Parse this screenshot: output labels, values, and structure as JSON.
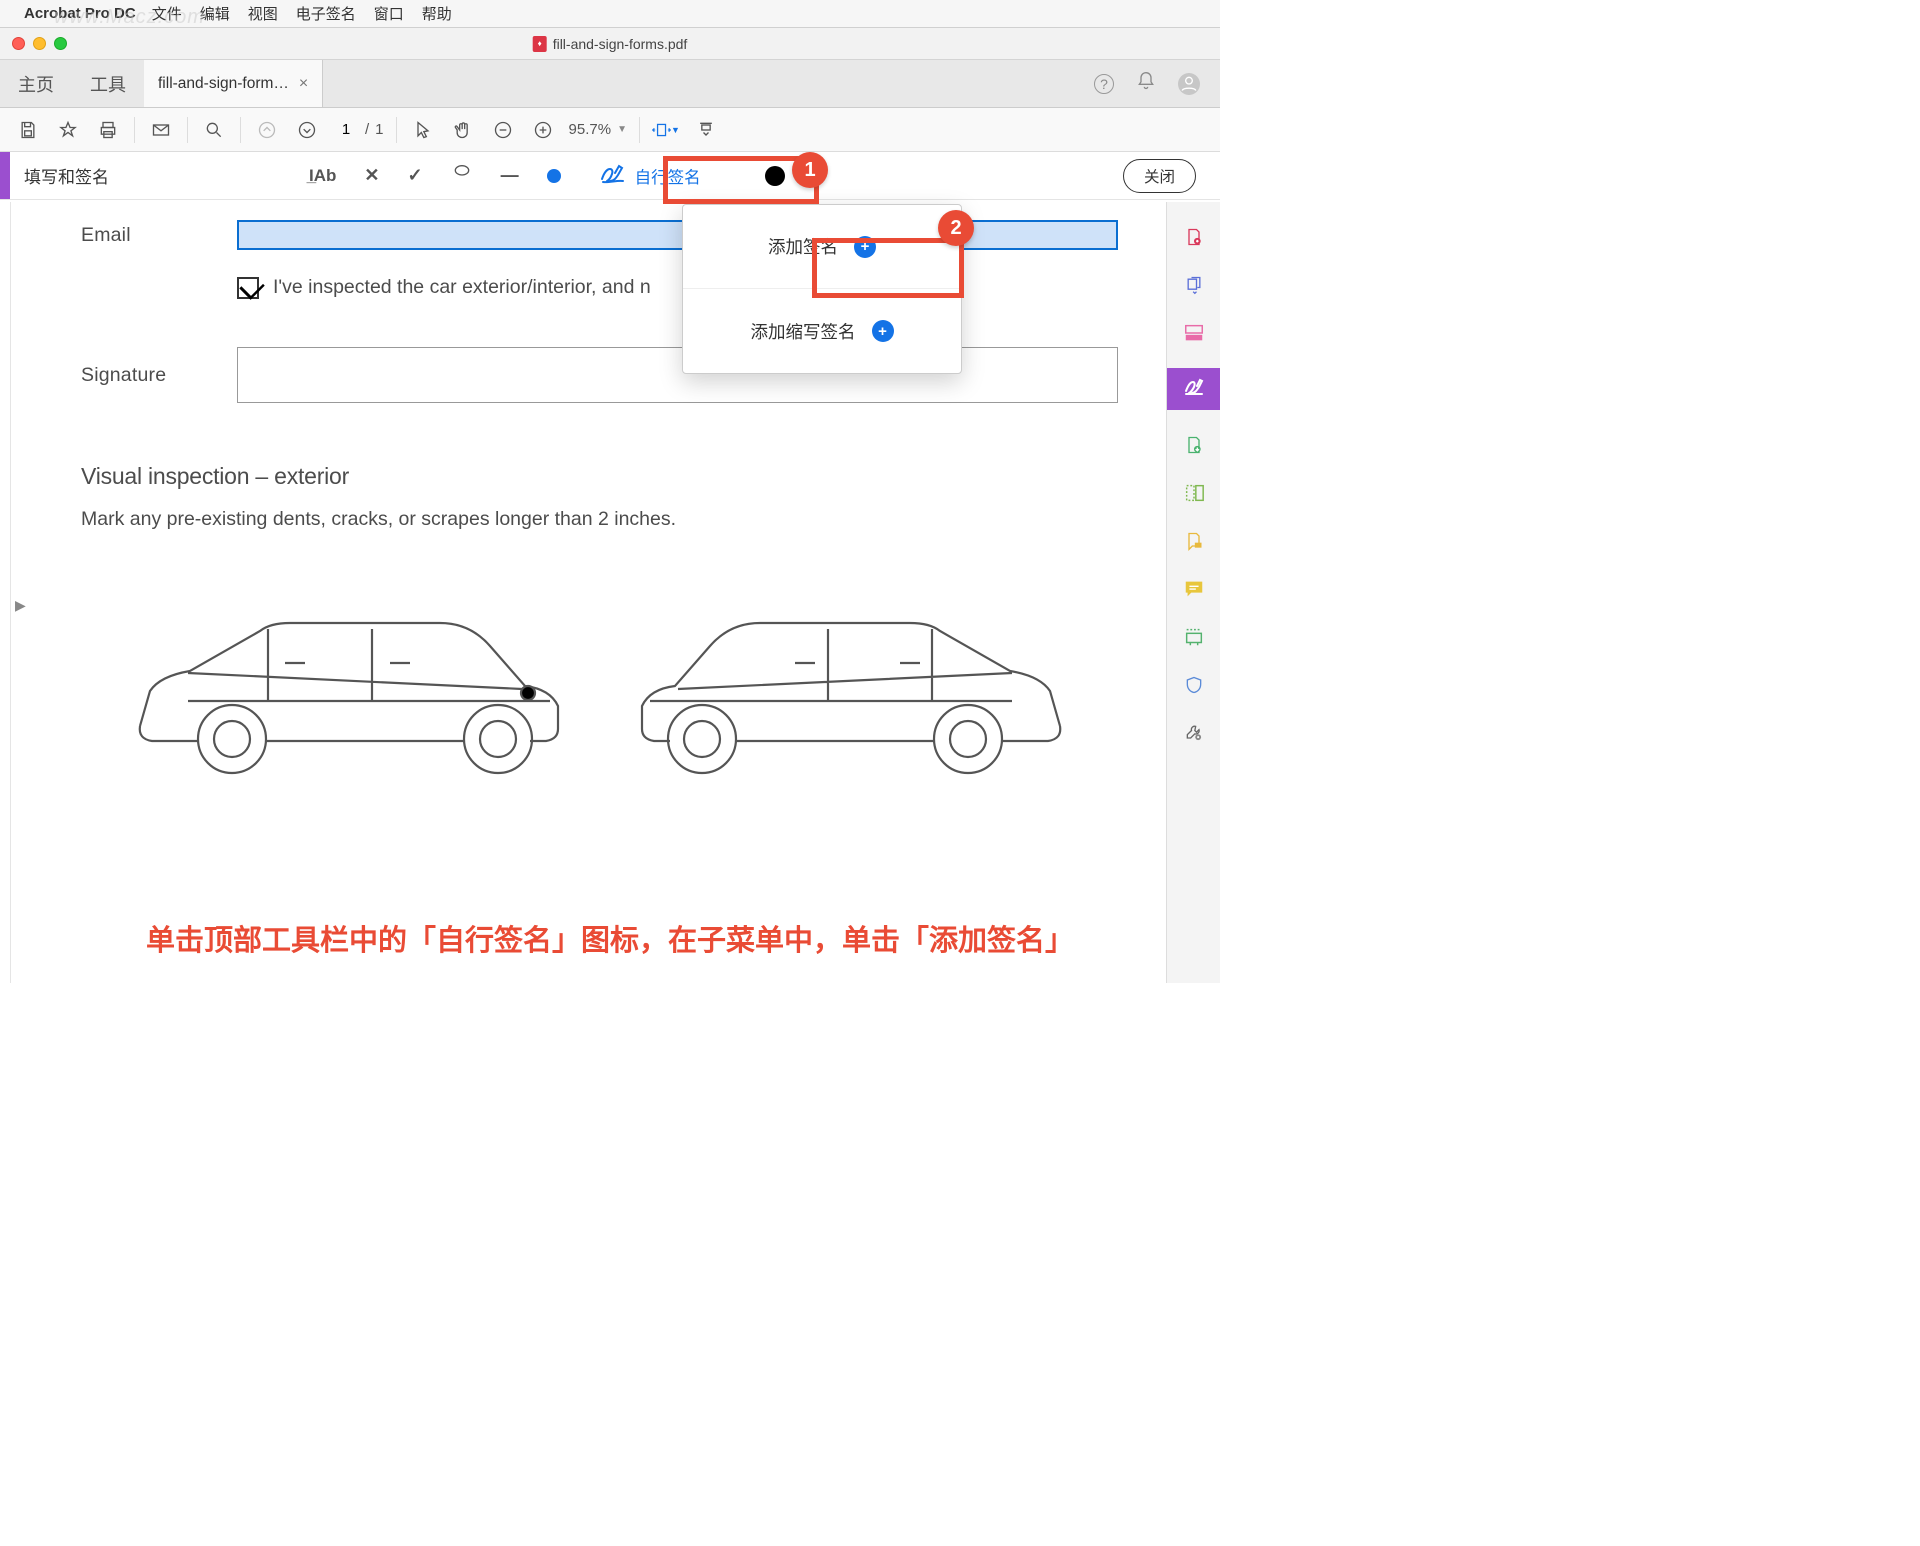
{
  "menubar": {
    "app": "Acrobat Pro DC",
    "items": [
      "文件",
      "编辑",
      "视图",
      "电子签名",
      "窗口",
      "帮助"
    ]
  },
  "window": {
    "title": "fill-and-sign-forms.pdf"
  },
  "tabs": {
    "home": "主页",
    "tools": "工具",
    "active": "fill-and-sign-form…"
  },
  "toolbar": {
    "page_current": "1",
    "page_total": "1",
    "zoom": "95.7%"
  },
  "fillsign": {
    "title": "填写和签名",
    "sign_label": "自行签名",
    "close": "关闭"
  },
  "dropdown": {
    "add_signature": "添加签名",
    "add_initials": "添加缩写签名"
  },
  "callouts": {
    "one": "1",
    "two": "2"
  },
  "document": {
    "email_label": "Email",
    "checkbox_text": "I've inspected the car exterior/interior, and n",
    "signature_label": "Signature",
    "section_heading": "Visual inspection – exterior",
    "section_text": "Mark any pre-existing dents, cracks, or scrapes longer than 2 inches."
  },
  "instruction": "单击顶部工具栏中的「自行签名」图标，在子菜单中，单击「添加签名」",
  "watermark": "www.Macz.com"
}
